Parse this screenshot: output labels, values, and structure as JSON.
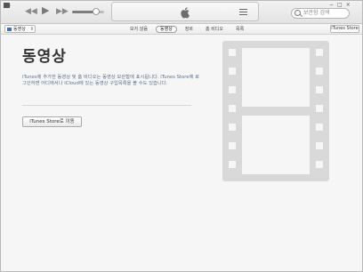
{
  "toolbar": {
    "prev_glyph": "◀◀",
    "play_glyph": "▶",
    "next_glyph": "▶▶",
    "volume_level": 0.75,
    "search_placeholder": "보관함 검색",
    "window_controls": "−□×"
  },
  "navbar": {
    "media_selector_label": "동영상",
    "media_selector_caret": "⇕",
    "tabs": [
      {
        "label": "보지 않음",
        "active": false
      },
      {
        "label": "동영상",
        "active": true
      },
      {
        "label": "장르",
        "active": false
      },
      {
        "label": "홈 비디오",
        "active": false
      },
      {
        "label": "목록",
        "active": false
      }
    ],
    "store_button_label": "iTunes Store"
  },
  "main": {
    "title": "동영상",
    "description": "iTunes에 추가한 동영상 및 홈 비디오는 동영상 보관함에 표시됩니다. iTunes Store에 로그인하면 어디에서나 iCloud에 있는 동영상 구입목록을 볼 수도 있습니다.",
    "store_link_button": "iTunes Store로 이동"
  },
  "colors": {
    "accent_blue": "#3c6fb8",
    "film_icon": "#d9d9d9"
  }
}
